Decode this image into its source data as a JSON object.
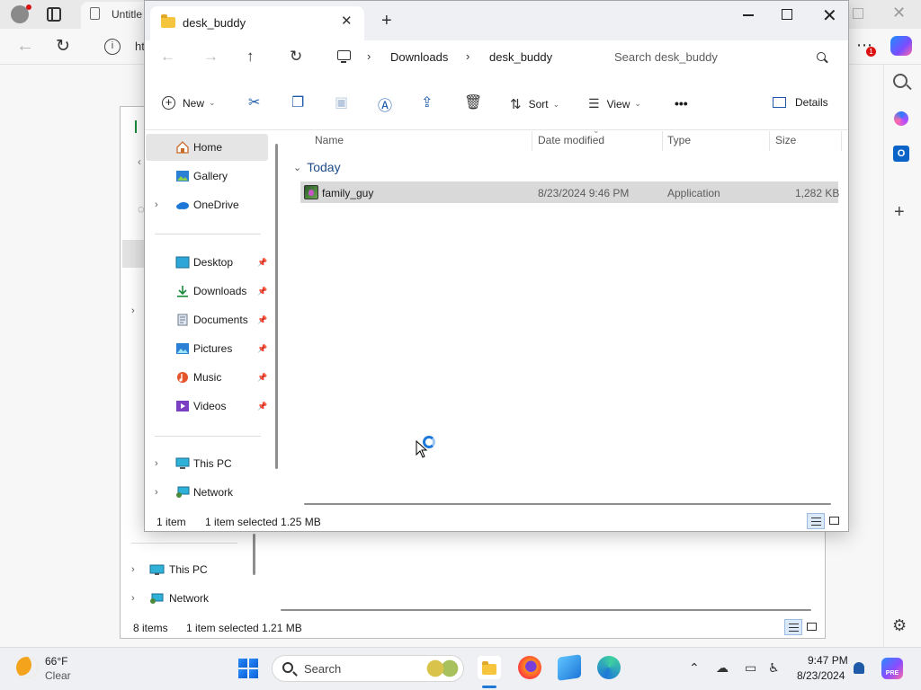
{
  "browser": {
    "tab_title": "Untitle",
    "url_partial": "ht",
    "notification_count": "1"
  },
  "back_window": {
    "nav": [
      {
        "label": "This PC"
      },
      {
        "label": "Network"
      }
    ],
    "status": {
      "items": "8 items",
      "selected": "1 item selected  1.21 MB"
    }
  },
  "window": {
    "tab_title": "desk_buddy",
    "breadcrumb": [
      "Downloads",
      "desk_buddy"
    ],
    "search_placeholder": "Search desk_buddy",
    "toolbar": {
      "new": "New",
      "sort": "Sort",
      "view": "View",
      "details": "Details",
      "more": "•••"
    },
    "nav": [
      {
        "label": "Home"
      },
      {
        "label": "Gallery"
      },
      {
        "label": "OneDrive"
      },
      {
        "label": "Desktop"
      },
      {
        "label": "Downloads"
      },
      {
        "label": "Documents"
      },
      {
        "label": "Pictures"
      },
      {
        "label": "Music"
      },
      {
        "label": "Videos"
      },
      {
        "label": "This PC"
      },
      {
        "label": "Network"
      }
    ],
    "columns": [
      "Name",
      "Date modified",
      "Type",
      "Size"
    ],
    "group": "Today",
    "files": [
      {
        "name": "family_guy",
        "date": "8/23/2024 9:46 PM",
        "type": "Application",
        "size": "1,282 KB"
      }
    ],
    "status": {
      "items": "1 item",
      "selected": "1 item selected  1.25 MB"
    }
  },
  "taskbar": {
    "weather_temp": "66°F",
    "weather_cond": "Clear",
    "search_label": "Search",
    "time": "9:47 PM",
    "date": "8/23/2024",
    "pre_badge": "PRE"
  },
  "colors": {
    "accent": "#1e78d8",
    "folder": "#f4c53d",
    "selection": "#d9d9d9"
  }
}
